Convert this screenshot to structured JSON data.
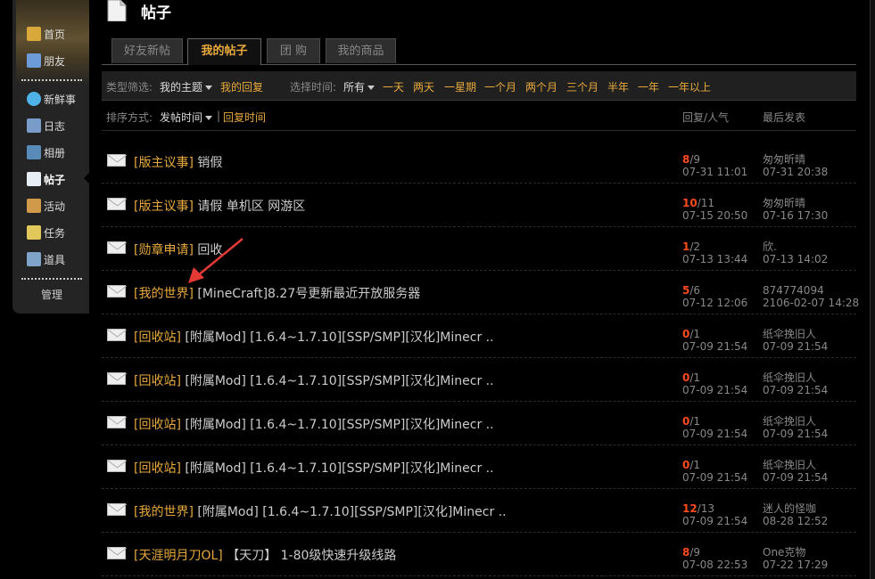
{
  "sidebar": {
    "items": [
      {
        "label": "首页",
        "icon": "home-icon"
      },
      {
        "label": "朋友",
        "icon": "friends-icon"
      },
      {
        "label": "新鲜事",
        "icon": "speech-bubble-icon"
      },
      {
        "label": "日志",
        "icon": "journal-icon"
      },
      {
        "label": "相册",
        "icon": "album-icon"
      },
      {
        "label": "帖子",
        "icon": "document-icon"
      },
      {
        "label": "活动",
        "icon": "activity-icon"
      },
      {
        "label": "任务",
        "icon": "task-icon"
      },
      {
        "label": "道具",
        "icon": "tool-icon"
      }
    ],
    "manage": "管理"
  },
  "header": {
    "title": "帖子"
  },
  "tabs": [
    "好友新帖",
    "我的帖子",
    "团 购",
    "我的商品"
  ],
  "filter": {
    "type_label": "类型筛选:",
    "type_value": "我的主题",
    "type_other": "我的回复",
    "time_label": "选择时间:",
    "time_value": "所有",
    "time_options": [
      "一天",
      "两天",
      "一星期",
      "一个月",
      "两个月",
      "三个月",
      "半年",
      "一年",
      "一年以上"
    ]
  },
  "sort": {
    "label": "排序方式:",
    "value": "发帖时间",
    "sep": "|",
    "other": "回复时间",
    "col_replies": "回复/人气",
    "col_last": "最后发表"
  },
  "posts": [
    {
      "forum": "[版主议事]",
      "subject": "销假",
      "replies": "8",
      "views": "/9",
      "date": "07-31 11:01",
      "last_user": "匆匆昕晴",
      "last_date": "07-31 20:38"
    },
    {
      "forum": "[版主议事]",
      "subject": "请假 单机区 网游区",
      "replies": "10",
      "views": "/11",
      "date": "07-15 20:50",
      "last_user": "匆匆昕晴",
      "last_date": "07-16 17:30"
    },
    {
      "forum": "[勋章申请]",
      "subject": "回收",
      "replies": "1",
      "views": "/2",
      "date": "07-13 13:44",
      "last_user": "欣.",
      "last_date": "07-13 14:02"
    },
    {
      "forum": "[我的世界]",
      "subject": "[MineCraft]8.27号更新最近开放服务器",
      "replies": "5",
      "views": "/6",
      "date": "07-12 12:06",
      "last_user": "874774094",
      "last_date": "2106-02-07 14:28"
    },
    {
      "forum": "[回收站]",
      "subject": "[附属Mod] [1.6.4~1.7.10][SSP/SMP][汉化]Minecr ..",
      "replies": "0",
      "views": "/1",
      "date": "07-09 21:54",
      "last_user": "纸伞挽旧人",
      "last_date": "07-09 21:54"
    },
    {
      "forum": "[回收站]",
      "subject": "[附属Mod] [1.6.4~1.7.10][SSP/SMP][汉化]Minecr ..",
      "replies": "0",
      "views": "/1",
      "date": "07-09 21:54",
      "last_user": "纸伞挽旧人",
      "last_date": "07-09 21:54"
    },
    {
      "forum": "[回收站]",
      "subject": "[附属Mod] [1.6.4~1.7.10][SSP/SMP][汉化]Minecr ..",
      "replies": "0",
      "views": "/1",
      "date": "07-09 21:54",
      "last_user": "纸伞挽旧人",
      "last_date": "07-09 21:54"
    },
    {
      "forum": "[回收站]",
      "subject": "[附属Mod] [1.6.4~1.7.10][SSP/SMP][汉化]Minecr ..",
      "replies": "0",
      "views": "/1",
      "date": "07-09 21:54",
      "last_user": "纸伞挽旧人",
      "last_date": "07-09 21:54"
    },
    {
      "forum": "[我的世界]",
      "subject": "[附属Mod] [1.6.4~1.7.10][SSP/SMP][汉化]Minecr ..",
      "replies": "12",
      "views": "/13",
      "date": "07-09 21:54",
      "last_user": "迷人的怪咖",
      "last_date": "08-28 12:52"
    },
    {
      "forum": "[天涯明月刀OL]",
      "subject": "【天刀】 1-80级快速升级线路",
      "replies": "8",
      "views": "/9",
      "date": "07-08 22:53",
      "last_user": "One克物",
      "last_date": "07-22 17:29"
    }
  ],
  "colors": {
    "accent": "#e7a93c",
    "reply": "#ff4a1c",
    "background": "#000000",
    "annotation_arrow": "#e53935"
  }
}
